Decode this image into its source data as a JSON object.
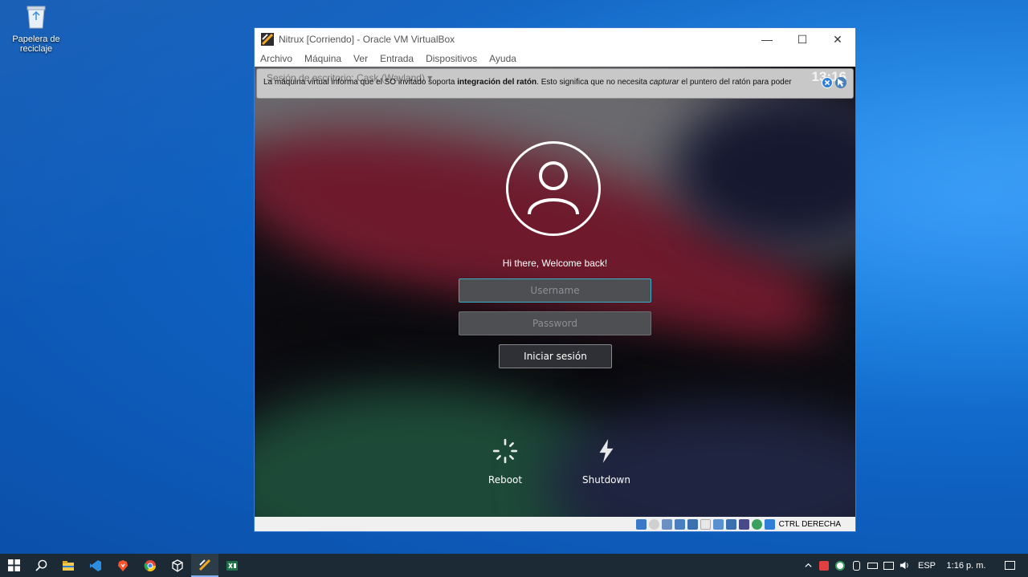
{
  "desktop": {
    "recycle_bin_label": "Papelera de reciclaje"
  },
  "window": {
    "title": "Nitrux [Corriendo] - Oracle VM VirtualBox",
    "menu": [
      "Archivo",
      "Máquina",
      "Ver",
      "Entrada",
      "Dispositivos",
      "Ayuda"
    ],
    "minimize_glyph": "—",
    "maximize_glyph": "☐",
    "close_glyph": "✕"
  },
  "notice": {
    "underlay_text": "Sesión de escritorio: Cask (Wayland)  ▾",
    "clock": "13:16",
    "part1": "La máquina virtual informa que el SO invitado soporta ",
    "bold": "integración del ratón",
    "part2": ". Esto significa que no necesita ",
    "italic": "capturar",
    "part3": " el puntero del ratón para poder"
  },
  "login": {
    "welcome": "Hi there, Welcome back!",
    "username_placeholder": "Username",
    "password_placeholder": "Password",
    "login_button": "Iniciar sesión",
    "reboot_label": "Reboot",
    "shutdown_label": "Shutdown"
  },
  "statusbar": {
    "host_key": "CTRL DERECHA"
  },
  "taskbar": {
    "apps": [
      "start-icon",
      "search-icon",
      "file-explorer-icon",
      "vscode-icon",
      "brave-icon",
      "chrome-icon",
      "virtualbox-app-icon",
      "virtualbox-vm-icon",
      "excel-icon"
    ],
    "language": "ESP",
    "time": "1:16 p. m."
  },
  "colors": {
    "accent": "#3bb1c8",
    "taskbar": "#1c2a36",
    "desktop": "#0e5fbf"
  }
}
